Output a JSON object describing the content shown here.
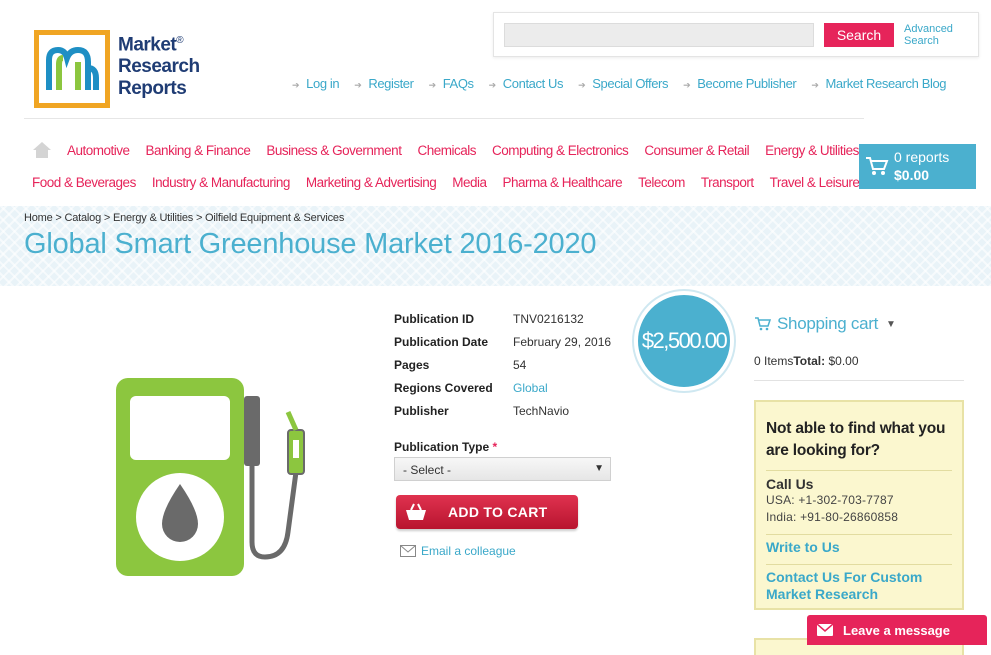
{
  "brand": {
    "logo_line1": "Market",
    "logo_line2": "Research",
    "logo_line3": "Reports",
    "registered": "®",
    "accent": "#e6245a",
    "primary": "#4bb0cf"
  },
  "search": {
    "placeholder": "",
    "button_label": "Search",
    "advanced_line1": "Advanced",
    "advanced_line2": "Search"
  },
  "top_links": [
    "Log in",
    "Register",
    "FAQs",
    "Contact Us",
    "Special Offers",
    "Become Publisher",
    "Market Research Blog"
  ],
  "categories_row1": [
    "Automotive",
    "Banking & Finance",
    "Business & Government",
    "Chemicals",
    "Computing & Electronics",
    "Consumer & Retail",
    "Energy & Utilities"
  ],
  "categories_row2": [
    "Food & Beverages",
    "Industry & Manufacturing",
    "Marketing & Advertising",
    "Media",
    "Pharma & Healthcare",
    "Telecom",
    "Transport",
    "Travel & Leisure"
  ],
  "header_cart": {
    "reports": "0 reports",
    "total": "$0.00"
  },
  "breadcrumb": [
    "Home",
    "Catalog",
    "Energy & Utilities",
    "Oilfield Equipment & Services"
  ],
  "breadcrumb_sep": " > ",
  "page_title": "Global Smart Greenhouse Market 2016-2020",
  "details": [
    {
      "label": "Publication ID",
      "value": "TNV0216132"
    },
    {
      "label": "Publication Date",
      "value": "February 29, 2016"
    },
    {
      "label": "Pages",
      "value": "54"
    },
    {
      "label": "Regions Covered",
      "value": "Global"
    },
    {
      "label": "Publisher",
      "value": "TechNavio"
    }
  ],
  "price": "$2,500.00",
  "publication_type": {
    "label": "Publication Type",
    "required_mark": "*",
    "selected": "- Select -"
  },
  "add_to_cart_label": "ADD TO CART",
  "email_colleague_label": "Email a colleague",
  "sidebar": {
    "cart_title": "Shopping cart",
    "items_text": "0 Items",
    "total_label": "Total:",
    "total_value": "$0.00",
    "help_question": "Not able to find what you are looking for?",
    "call_us": "Call Us",
    "phone_usa": "USA: +1-302-703-7787",
    "phone_india": "India: +91-80-26860858",
    "write_to_us": "Write to Us",
    "custom_research": "Contact Us For Custom Market Research"
  },
  "leave_message_label": "Leave a message"
}
